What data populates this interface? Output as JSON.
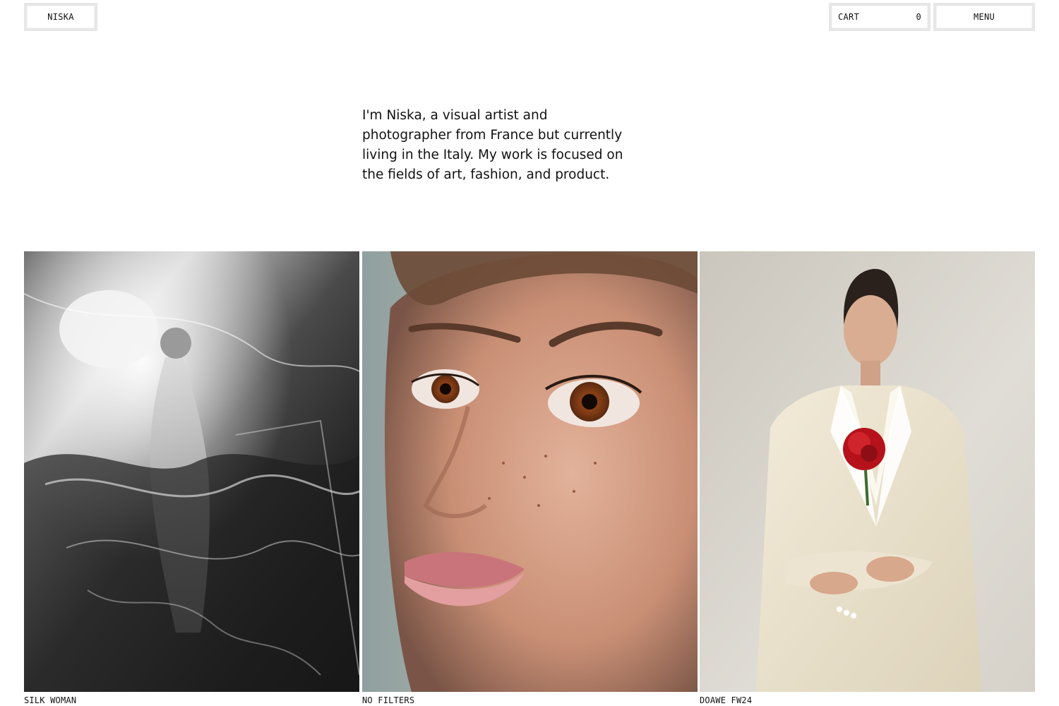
{
  "header": {
    "logo_label": "NISKA",
    "cart_label": "CART",
    "cart_count": "0",
    "menu_label": "MENU"
  },
  "intro": {
    "text": "I'm Niska, a visual artist and photographer from France but currently living in the Italy. My work is focused on the fields of art, fashion, and product."
  },
  "projects": [
    {
      "title": "SILK WOMAN",
      "image": "black-and-white photo of a woman wrapped in translucent plastic"
    },
    {
      "title": "NO FILTERS",
      "image": "close-up portrait of a freckled woman's face"
    },
    {
      "title": "DOAWE FW24",
      "image": "woman in a cream suit holding a red rose"
    }
  ],
  "colors": {
    "background": "#ffffff",
    "text": "#111111",
    "button_border": "#e7e7e7"
  }
}
